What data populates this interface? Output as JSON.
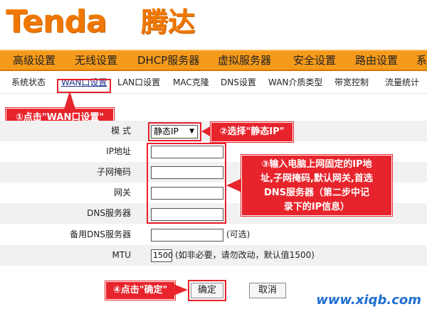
{
  "logo": {
    "brand_en": "Tenda",
    "brand_cn": "腾达"
  },
  "main_nav": [
    "高级设置",
    "无线设置",
    "DHCP服务器",
    "虚拟服务器",
    "安全设置",
    "路由设置",
    "系"
  ],
  "sub_nav": [
    "系统状态",
    "WAN口设置",
    "LAN口设置",
    "MAC克隆",
    "DNS设置",
    "WAN介质类型",
    "带宽控制",
    "流量统计"
  ],
  "form": {
    "mode_label": "模 式",
    "mode_value": "静态IP",
    "ip_label": "IP地址",
    "mask_label": "子网掩码",
    "gateway_label": "网关",
    "dns_label": "DNS服务器",
    "dns2_label": "备用DNS服务器",
    "dns2_hint": "(可选)",
    "mtu_label": "MTU",
    "mtu_value": "1500",
    "mtu_hint": "(如非必要，请勿改动，默认值1500)"
  },
  "buttons": {
    "ok": "确定",
    "cancel": "取消"
  },
  "callouts": {
    "step1": "①点击\"WAN口设置\"",
    "step2": "②选择\"静态IP\"",
    "step3_lines": [
      "③输入电脑上网固定的IP地",
      "址,子网掩码,默认网关,首选",
      "DNS服务器（第二步中记",
      "录下的IP信息）"
    ],
    "step4": "④点击\"确定\""
  },
  "watermark": "www.xiqb.com",
  "colors": {
    "brand_orange": "#f07800",
    "nav_orange": "#f59a1b",
    "callout_red": "#e7242b",
    "watermark_blue": "#1f6fd2"
  }
}
